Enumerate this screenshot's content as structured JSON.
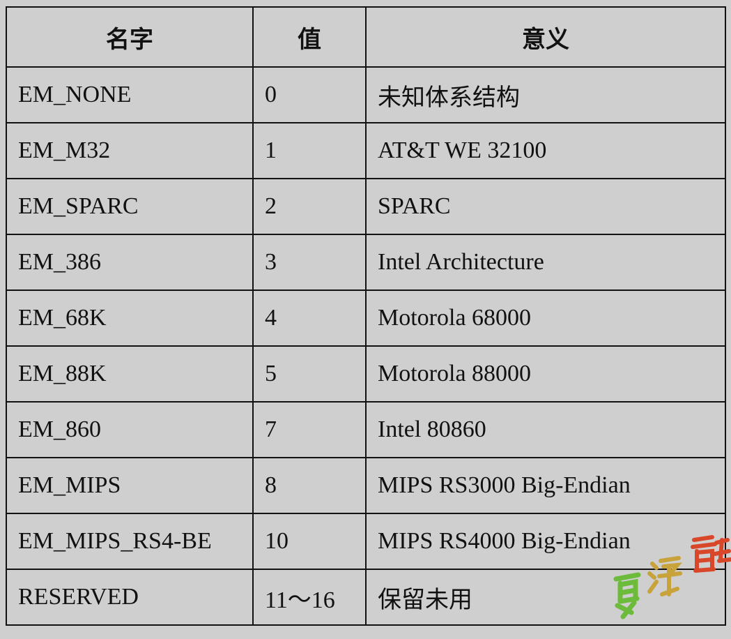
{
  "table": {
    "headers": [
      "名字",
      "值",
      "意义"
    ],
    "rows": [
      [
        "EM_NONE",
        "0",
        "未知体系结构"
      ],
      [
        "EM_M32",
        "1",
        "AT&T WE 32100"
      ],
      [
        "EM_SPARC",
        "2",
        "SPARC"
      ],
      [
        "EM_386",
        "3",
        "Intel Architecture"
      ],
      [
        "EM_68K",
        "4",
        "Motorola 68000"
      ],
      [
        "EM_88K",
        "5",
        "Motorola 88000"
      ],
      [
        "EM_860",
        "7",
        "Intel 80860"
      ],
      [
        "EM_MIPS",
        "8",
        "MIPS RS3000 Big-Endian"
      ],
      [
        "EM_MIPS_RS4-BE",
        "10",
        "MIPS RS4000 Big-Endian"
      ],
      [
        "RESERVED",
        "11～16",
        "保留未用"
      ]
    ]
  },
  "watermark": {
    "text": "夏语魂",
    "colors": [
      "#6dbb3a",
      "#c8a23a",
      "#d9472b"
    ]
  }
}
